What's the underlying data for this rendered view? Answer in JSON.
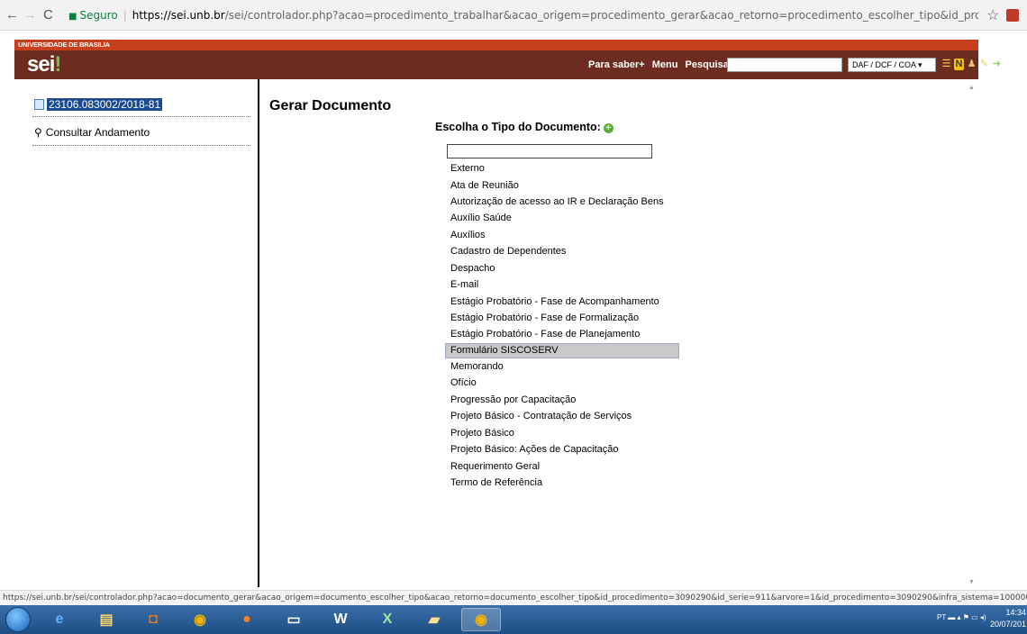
{
  "browser": {
    "secure_label": "Seguro",
    "url_domain": "https://sei.unb.br",
    "url_path": "/sei/controlador.php?acao=procedimento_trabalhar&acao_origem=procedimento_gerar&acao_retorno=procedimento_escolher_tipo&id_procedimento=3090290&atuali...",
    "status_url": "https://sei.unb.br/sei/controlador.php?acao=documento_gerar&acao_origem=documento_escolher_tipo&acao_retorno=documento_escolher_tipo&id_procedimento=3090290&id_serie=911&arvore=1&id_procedimento=3090290&infra_sistema=100000100&infra_..."
  },
  "header": {
    "institution": "UNIVERSIDADE DE BRASILIA",
    "logo": "sei",
    "logo_mark": "!",
    "links": [
      "Para saber+",
      "Menu",
      "Pesquisa"
    ],
    "search_value": "",
    "unit_selected": "DAF / DCF / COA"
  },
  "tree": {
    "process_number": "23106.083002/2018-81",
    "consultar_label": "Consultar Andamento"
  },
  "main": {
    "title": "Gerar Documento",
    "choose_label": "Escolha o Tipo do Documento:",
    "filter_value": "",
    "doc_types": [
      "Externo",
      "Ata de Reunião",
      "Autorização de acesso ao IR e Declaração Bens",
      "Auxílio Saúde",
      "Auxílios",
      "Cadastro de Dependentes",
      "Despacho",
      "E-mail",
      "Estágio Probatório - Fase de Acompanhamento",
      "Estágio Probatório - Fase de Formalização",
      "Estágio Probatório - Fase de Planejamento",
      "Formulário SISCOSERV",
      "Memorando",
      "Ofício",
      "Progressão por Capacitação",
      "Projeto Básico - Contratação de Serviços",
      "Projeto Básico",
      "Projeto Básico: Ações de Capacitação",
      "Requerimento Geral",
      "Termo de Referência"
    ],
    "highlighted_index": 11
  },
  "taskbar": {
    "tray_lang": "PT",
    "time": "14:34",
    "date": "20/07/201"
  }
}
